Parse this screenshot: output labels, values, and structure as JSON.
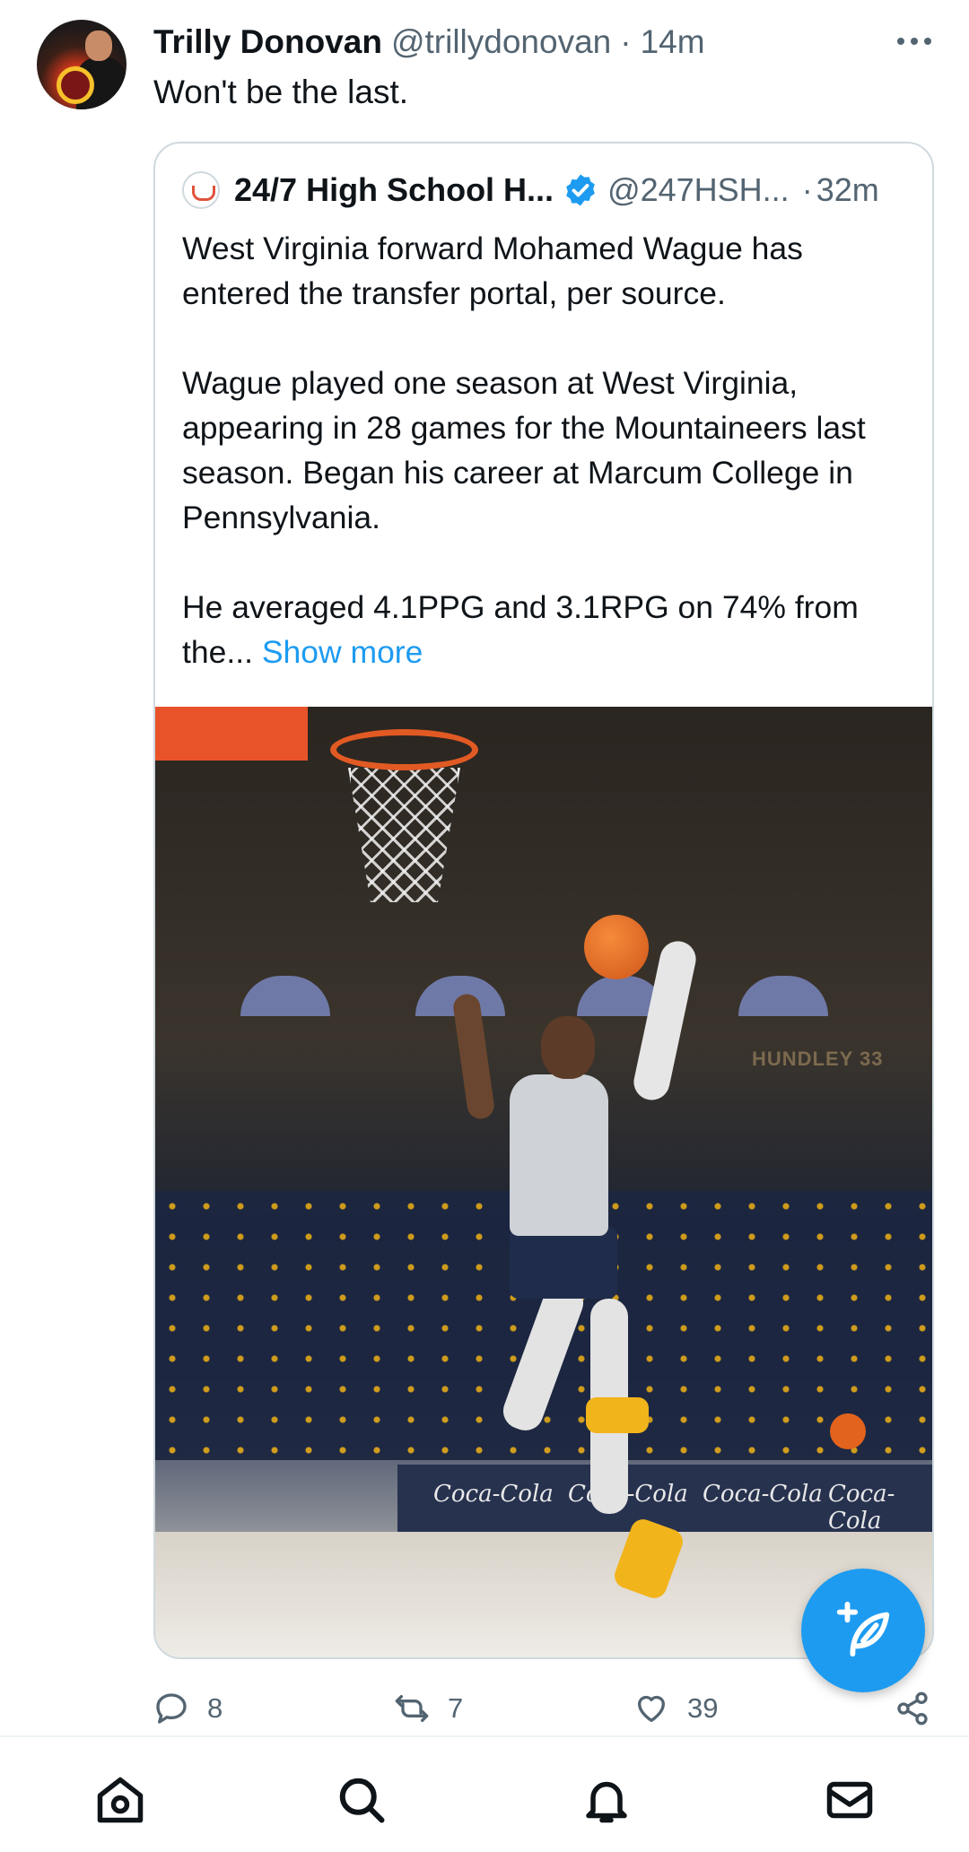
{
  "tweet": {
    "name": "Trilly Donovan",
    "handle": "@trillydonovan",
    "separator": "·",
    "time": "14m",
    "text": "Won't be the last."
  },
  "quote": {
    "name": "24/7 High School H...",
    "handle": "@247HSH...",
    "separator": "·",
    "time": "32m",
    "paragraph1": "West Virginia forward Mohamed Wague has entered the transfer portal, per source.",
    "paragraph2": "Wague played one season at West Virginia, appearing in 28 games for the Mountaineers last season. Began his career at Marcum College in Pennsylvania.",
    "paragraph3": "He averaged 4.1PPG and 3.1RPG on 74% from the...",
    "show_more": "Show more",
    "image": {
      "arena_sign": "HUNDLEY 33",
      "banner_text": [
        "Coca-Cola",
        "Coca-Cola",
        "Coca-Cola",
        "Coca-Cola"
      ]
    }
  },
  "actions": {
    "replies": "8",
    "retweets": "7",
    "likes": "39"
  },
  "icons": {
    "reply": "reply-icon",
    "retweet": "retweet-icon",
    "like": "heart-icon",
    "share": "share-icon",
    "compose": "compose-icon",
    "home": "home-icon",
    "search": "search-icon",
    "notifications": "bell-icon",
    "messages": "mail-icon",
    "verified": "verified-badge-icon",
    "more": "more-dots-icon"
  },
  "colors": {
    "accent": "#1d9bf0",
    "text": "#0f1419",
    "secondary": "#536471",
    "border": "#cfd9de"
  }
}
